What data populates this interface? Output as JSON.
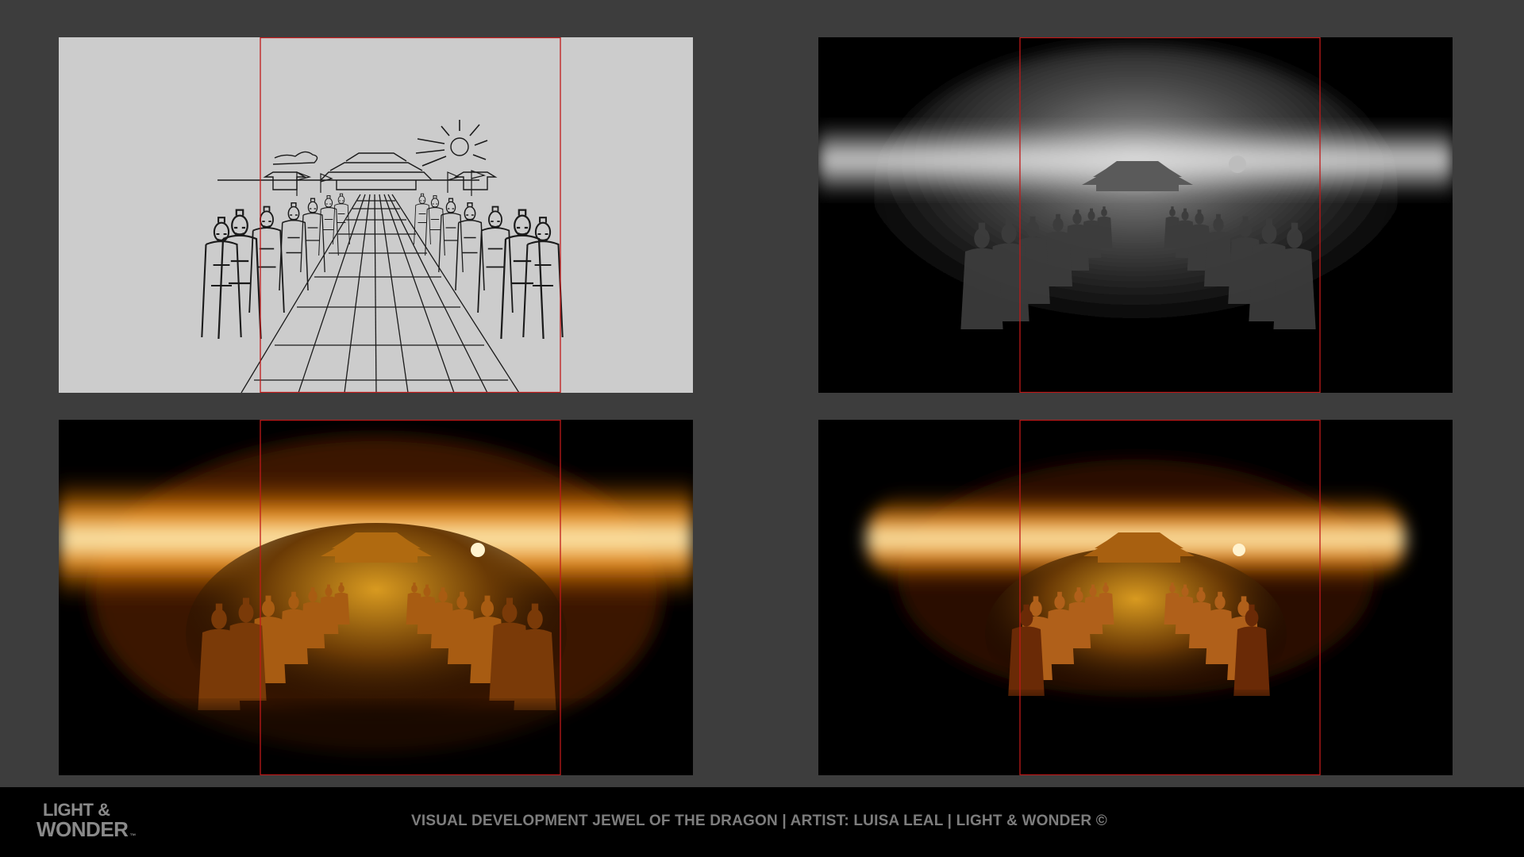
{
  "colors": {
    "background": "#3d3d3d",
    "sketch_paper": "#cccccc",
    "sketch_ink": "#1a1a1a",
    "frame_guide": "#c01818",
    "glow_warm": "#ffb020",
    "glow_core": "#fff0b0",
    "footer_bg": "#000000",
    "footer_text": "#7d7d7d"
  },
  "panels": [
    {
      "stage": "line-sketch"
    },
    {
      "stage": "grayscale-value"
    },
    {
      "stage": "color-glow-wide"
    },
    {
      "stage": "color-glow-focused"
    }
  ],
  "footer": {
    "logo_line1": "LIGHT &",
    "logo_line2": "WONDER",
    "logo_mark": "™",
    "caption": "VISUAL DEVELOPMENT JEWEL OF THE DRAGON | ARTIST: LUISA LEAL | LIGHT & WONDER ©"
  }
}
